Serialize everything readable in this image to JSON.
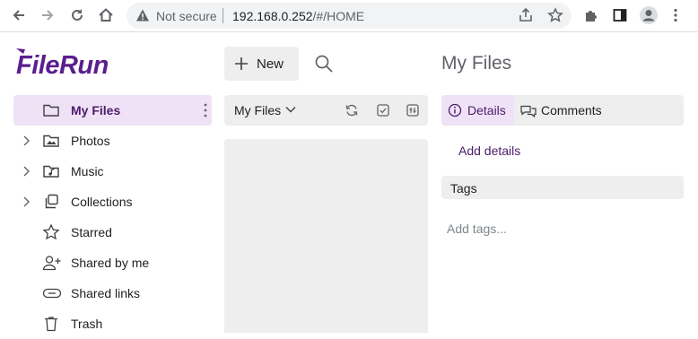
{
  "browser": {
    "security_label": "Not secure",
    "url_host": "192.168.0.252",
    "url_path": "/#/HOME"
  },
  "app": {
    "logo_text": "FileRun",
    "brand_color": "#5b1e8e",
    "accent_bg": "#f0e2f6"
  },
  "sidebar": {
    "items": [
      {
        "label": "My Files",
        "icon": "folder-icon"
      },
      {
        "label": "Photos",
        "icon": "photos-icon"
      },
      {
        "label": "Music",
        "icon": "music-icon"
      },
      {
        "label": "Collections",
        "icon": "collections-icon"
      },
      {
        "label": "Starred",
        "icon": "star-icon"
      },
      {
        "label": "Shared by me",
        "icon": "shared-by-me-icon"
      },
      {
        "label": "Shared links",
        "icon": "link-icon"
      },
      {
        "label": "Trash",
        "icon": "trash-icon"
      }
    ]
  },
  "toolbar": {
    "new_label": "New",
    "folder_title": "My Files"
  },
  "details": {
    "title": "My Files",
    "tab_details": "Details",
    "tab_comments": "Comments",
    "add_details": "Add details",
    "tags_header": "Tags",
    "add_tags_placeholder": "Add tags..."
  }
}
